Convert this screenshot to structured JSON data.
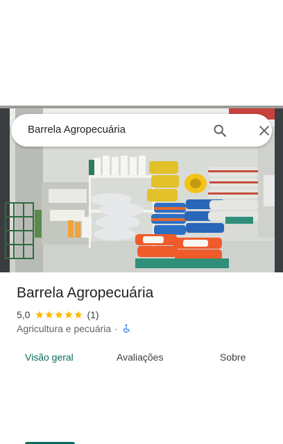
{
  "search": {
    "query": "Barrela Agropecuária"
  },
  "place": {
    "name": "Barrela Agropecuária",
    "rating": "5,0",
    "stars": 5,
    "review_count": "(1)",
    "category": "Agricultura e pecuária",
    "separator": "·"
  },
  "tabs": [
    {
      "label": "Visão geral",
      "active": true
    },
    {
      "label": "Avaliações",
      "active": false
    },
    {
      "label": "Sobre",
      "active": false
    }
  ],
  "colors": {
    "accent": "#0b6b5e",
    "star": "#fbbc04",
    "accessibility": "#1a73e8"
  },
  "icons": [
    "search-icon",
    "close-icon",
    "star-icon",
    "wheelchair-icon"
  ]
}
